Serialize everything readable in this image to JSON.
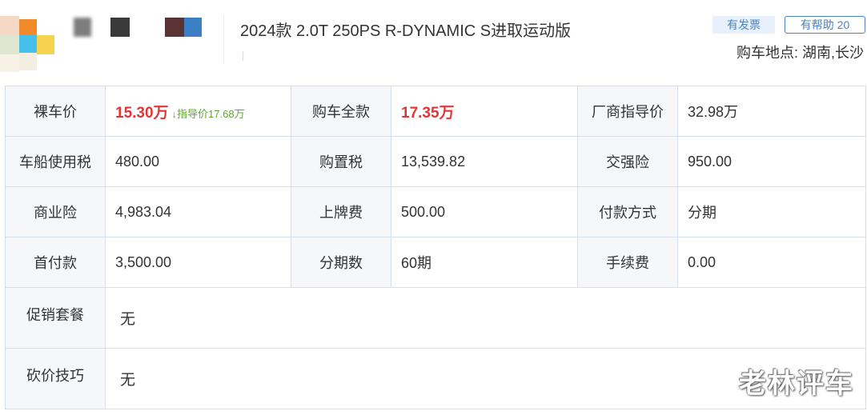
{
  "header": {
    "car_title": "2024款 2.0T 250PS R-DYNAMIC S进取运动版",
    "invoice_badge": "有发票",
    "helpful_button": "有帮助 20",
    "buy_location": "购车地点: 湖南,长沙"
  },
  "colors": {
    "accent_blue": "#4a83c6",
    "price_red": "#e23636",
    "hint_green": "#5aaa2a",
    "label_bg": "#f5f7fa",
    "border": "#d6e0ec"
  },
  "price_rows": [
    {
      "c1_label": "裸车价",
      "c1_value": "15.30万",
      "c1_hint": "↓指导价17.68万",
      "c2_label": "购车全款",
      "c2_value": "17.35万",
      "c3_label": "厂商指导价",
      "c3_value": "32.98万"
    },
    {
      "c1_label": "车船使用税",
      "c1_value": "480.00",
      "c2_label": "购置税",
      "c2_value": "13,539.82",
      "c3_label": "交强险",
      "c3_value": "950.00"
    },
    {
      "c1_label": "商业险",
      "c1_value": "4,983.04",
      "c2_label": "上牌费",
      "c2_value": "500.00",
      "c3_label": "付款方式",
      "c3_value": "分期"
    },
    {
      "c1_label": "首付款",
      "c1_value": "3,500.00",
      "c2_label": "分期数",
      "c2_value": "60期",
      "c3_label": "手续费",
      "c3_value": "0.00"
    }
  ],
  "promo": {
    "label": "促销套餐",
    "value": "无"
  },
  "bargain": {
    "label": "砍价技巧",
    "value": "无"
  },
  "watermark": "老林评车"
}
